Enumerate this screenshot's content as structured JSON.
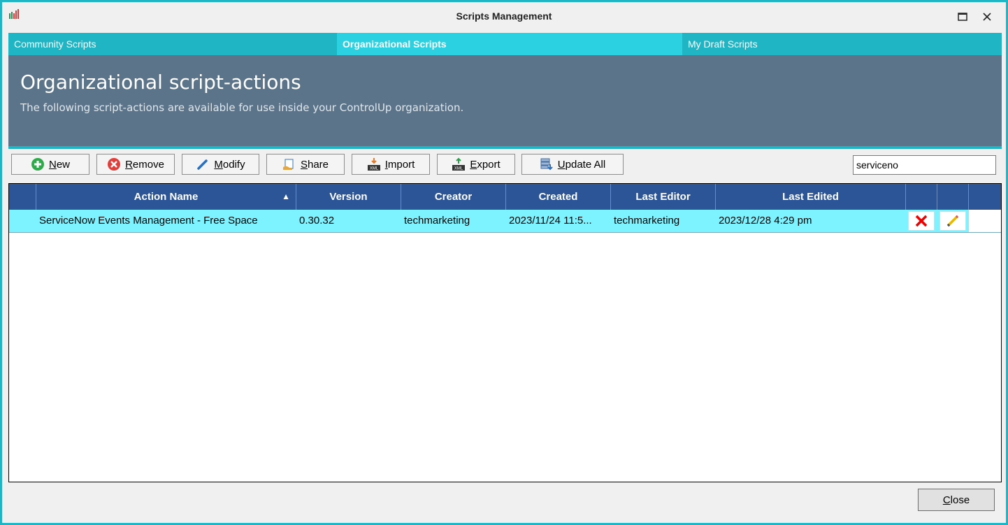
{
  "window": {
    "title": "Scripts Management",
    "icons": [
      "app-bars-icon",
      "maximize-icon",
      "close-icon"
    ]
  },
  "tabs": [
    {
      "label": "Community Scripts",
      "active": false
    },
    {
      "label": "Organizational Scripts",
      "active": true
    },
    {
      "label": "My Draft Scripts",
      "active": false
    }
  ],
  "banner": {
    "title": "Organizational script-actions",
    "subtitle": "The following script-actions are available for use inside your ControlUp organization."
  },
  "toolbar": {
    "buttons": [
      {
        "key": "N",
        "rest": "ew",
        "icon": "plus-circle-icon"
      },
      {
        "key": "R",
        "rest": "emove",
        "icon": "remove-circle-icon"
      },
      {
        "key": "M",
        "rest": "odify",
        "icon": "pencil-icon"
      },
      {
        "key": "S",
        "rest": "hare",
        "icon": "share-icon"
      },
      {
        "key": "I",
        "rest": "mport",
        "icon": "xml-import-icon"
      },
      {
        "key": "E",
        "rest": "xport",
        "icon": "xml-export-icon"
      },
      {
        "key": "U",
        "rest": "pdate All",
        "icon": "update-icon"
      }
    ],
    "search_value": "serviceno"
  },
  "grid": {
    "columns": [
      "",
      "Action Name",
      "Version",
      "Creator",
      "Created",
      "Last Editor",
      "Last Edited",
      "",
      "",
      ""
    ],
    "sort_indicator": "▲",
    "rows": [
      {
        "action_name": "ServiceNow Events Management - Free Space",
        "version": "0.30.32",
        "creator": "techmarketing",
        "created": "2023/11/24 11:5...",
        "last_editor": "techmarketing",
        "last_edited": "2023/12/28 4:29 pm"
      }
    ]
  },
  "footer": {
    "close_key": "C",
    "close_rest": "lose"
  },
  "colors": {
    "accent": "#1fb5c4",
    "active_tab": "#2bd1e0",
    "banner": "#5b7489",
    "grid_header": "#2b5597",
    "selected_row": "#7df3ff"
  }
}
